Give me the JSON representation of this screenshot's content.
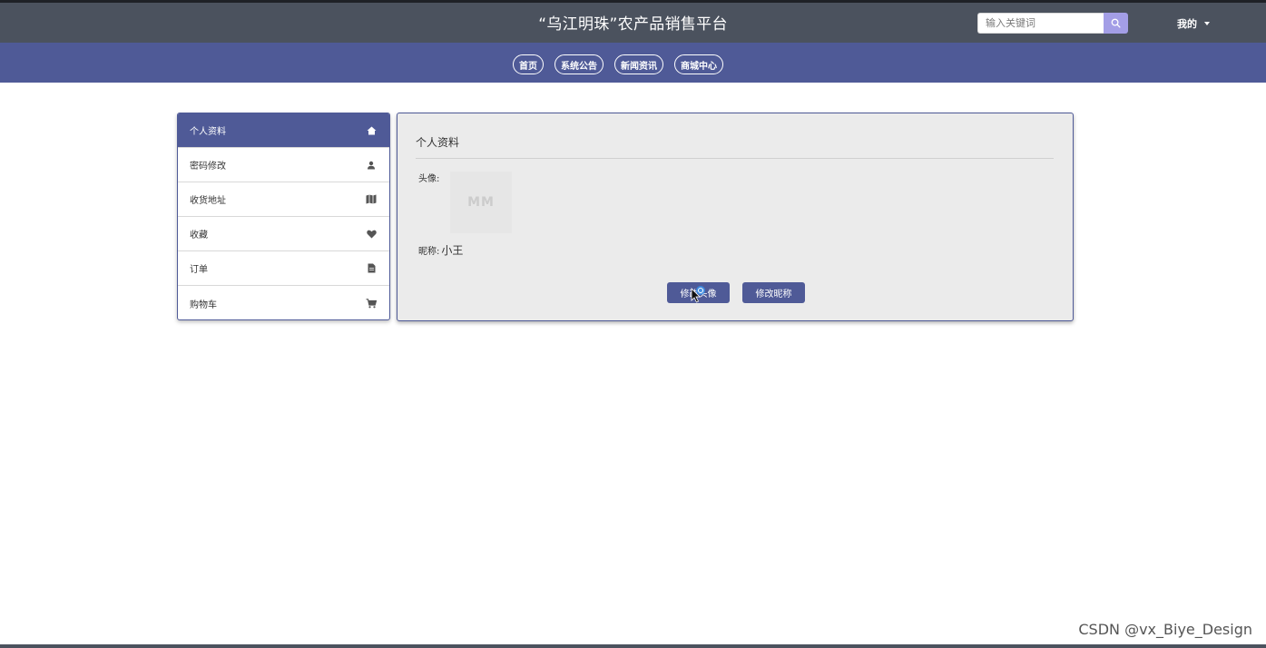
{
  "header": {
    "title": "“乌江明珠”农产品销售平台",
    "search": {
      "placeholder": "输入关键词",
      "value": ""
    },
    "user_menu_label": "我的"
  },
  "nav": {
    "items": [
      {
        "label": "首页"
      },
      {
        "label": "系统公告"
      },
      {
        "label": "新闻资讯"
      },
      {
        "label": "商城中心"
      }
    ]
  },
  "sidebar": {
    "items": [
      {
        "label": "个人资料",
        "icon": "home-icon",
        "active": true
      },
      {
        "label": "密码修改",
        "icon": "user-icon",
        "active": false
      },
      {
        "label": "收货地址",
        "icon": "map-icon",
        "active": false
      },
      {
        "label": "收藏",
        "icon": "heart-icon",
        "active": false
      },
      {
        "label": "订单",
        "icon": "file-icon",
        "active": false
      },
      {
        "label": "购物车",
        "icon": "cart-icon",
        "active": false
      }
    ]
  },
  "profile": {
    "title": "个人资料",
    "avatar_label": "头像:",
    "avatar_placeholder": "MM",
    "nickname_label": "昵称:",
    "nickname_value": "小王",
    "change_avatar_label": "修改头像",
    "change_nickname_label": "修改昵称"
  },
  "watermark": "CSDN @vx_Biye_Design",
  "colors": {
    "topbar": "#4b525e",
    "navbar": "#4f5a97",
    "accent": "#4f5a97",
    "search_button": "#a39ee6",
    "panel_bg": "#ebebeb"
  }
}
